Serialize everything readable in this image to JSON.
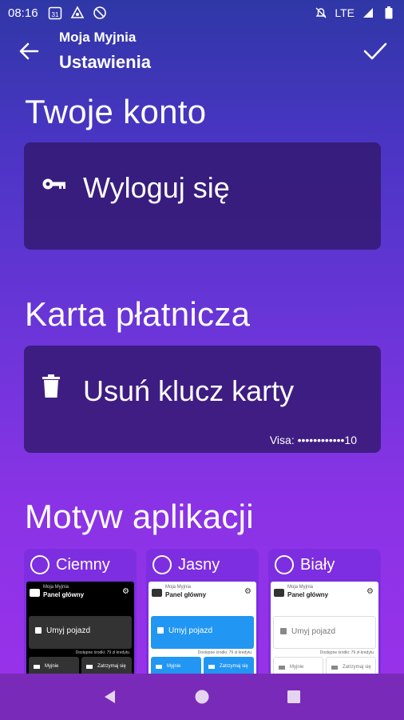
{
  "status_bar": {
    "time": "08:16",
    "calendar_badge": "31",
    "network": "LTE"
  },
  "appbar": {
    "subtitle": "Moja Myjnia",
    "title": "Ustawienia"
  },
  "account": {
    "heading": "Twoje konto",
    "logout_label": "Wyloguj się"
  },
  "payment": {
    "heading": "Karta płatnicza",
    "remove_label": "Usuń klucz karty",
    "card_info": "Visa: ••••••••••••10"
  },
  "theme": {
    "heading": "Motyw aplikacji",
    "options": [
      {
        "label": "Ciemny",
        "preview": {
          "subtitle": "Moja Myjnia",
          "title": "Panel główny",
          "main": "Umyj pojazd",
          "foot": "Dostępne środki: 79 zł kredytu",
          "btn1": "Myjnie",
          "btn2": "Zatrzymaj się"
        }
      },
      {
        "label": "Jasny",
        "preview": {
          "subtitle": "Moja Myjnia",
          "title": "Panel główny",
          "main": "Umyj pojazd",
          "foot": "Dostępne środki: 79 zł kredytu",
          "btn1": "Myjnie",
          "btn2": "Zatrzymaj się"
        }
      },
      {
        "label": "Biały",
        "preview": {
          "subtitle": "Moja Myjnia",
          "title": "Panel główny",
          "main": "Umyj pojazd",
          "foot": "Dostępne środki: 79 zł kredytu",
          "btn1": "Myjnie",
          "btn2": "Zatrzymaj się"
        }
      }
    ]
  },
  "colors": {
    "accent": "#7d2ee0",
    "card_bg": "#32196e",
    "nav_bg": "#7a2ab8"
  }
}
